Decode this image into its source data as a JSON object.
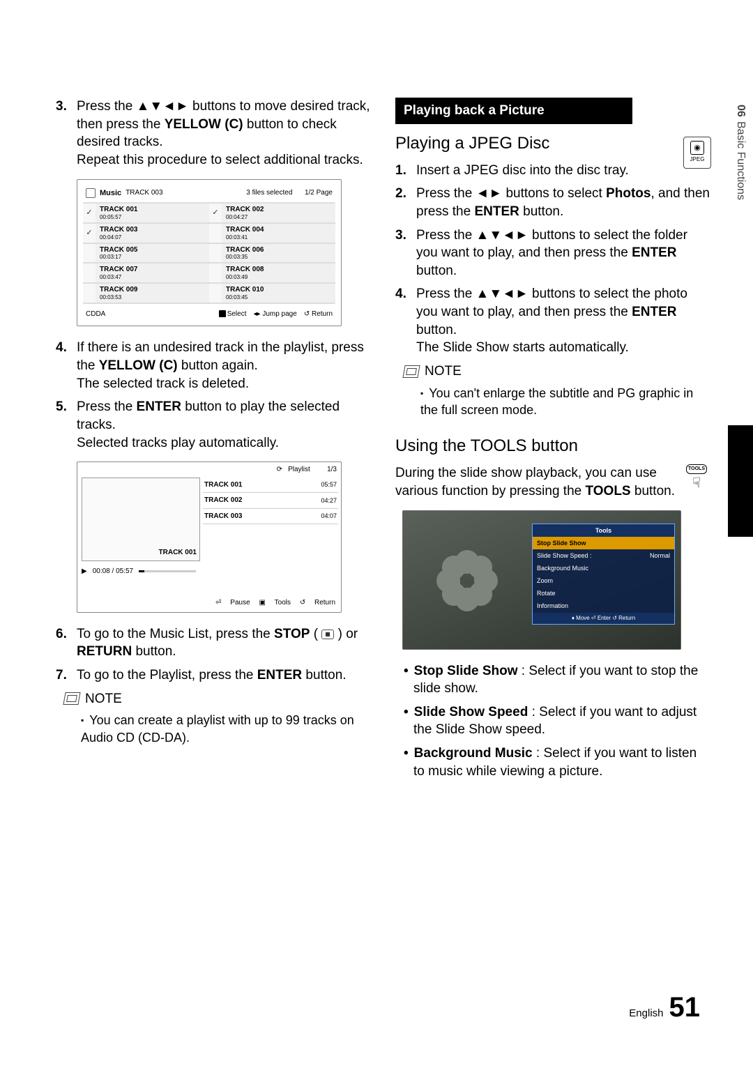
{
  "side": {
    "chapter": "06",
    "title": "Basic Functions"
  },
  "left": {
    "s3": {
      "num": "3.",
      "l1a": "Press the ",
      "l1arrows": "▲▼◄►",
      "l1b": " buttons to move desired track, then press the ",
      "l1c": "YELLOW (C)",
      "l1d": " button to check desired tracks.",
      "l2": "Repeat this procedure to select additional tracks."
    },
    "fig1": {
      "icon_title": "Music",
      "current": "TRACK 003",
      "files": "3 files selected",
      "page": "1/2 Page",
      "tracks": [
        {
          "chk": "✓",
          "name": "TRACK 001",
          "time": "00:05:57"
        },
        {
          "chk": "✓",
          "name": "TRACK 002",
          "time": "00:04:27"
        },
        {
          "chk": "✓",
          "name": "TRACK 003",
          "time": "00:04:07"
        },
        {
          "chk": "",
          "name": "TRACK 004",
          "time": "00:03:41"
        },
        {
          "chk": "",
          "name": "TRACK 005",
          "time": "00:03:17"
        },
        {
          "chk": "",
          "name": "TRACK 006",
          "time": "00:03:35"
        },
        {
          "chk": "",
          "name": "TRACK 007",
          "time": "00:03:47"
        },
        {
          "chk": "",
          "name": "TRACK 008",
          "time": "00:03:49"
        },
        {
          "chk": "",
          "name": "TRACK 009",
          "time": "00:03:53"
        },
        {
          "chk": "",
          "name": "TRACK 010",
          "time": "00:03:45"
        }
      ],
      "src": "CDDA",
      "k_select": "Select",
      "k_jump": "Jump page",
      "k_return": "Return"
    },
    "s4": {
      "num": "4.",
      "a": "If there is an undesired track in the playlist, press the ",
      "b": "YELLOW (C)",
      "c": " button again.",
      "d": "The selected track is deleted."
    },
    "s5": {
      "num": "5.",
      "a": "Press the ",
      "b": "ENTER",
      "c": " button to play the selected tracks.",
      "d": "Selected tracks play automatically."
    },
    "fig2": {
      "hdr_icon": "⟳",
      "hdr_label": "Playlist",
      "hdr_page": "1/3",
      "art": "TRACK 001",
      "rows": [
        {
          "n": "TRACK 001",
          "t": "05:57"
        },
        {
          "n": "TRACK 002",
          "t": "04:27"
        },
        {
          "n": "TRACK 003",
          "t": "04:07"
        }
      ],
      "prog": "00:08 / 05:57",
      "f_pause": "Pause",
      "f_tools": "Tools",
      "f_return": "Return"
    },
    "s6": {
      "num": "6.",
      "a": "To go to the Music List, press the ",
      "b": "STOP",
      "c": " ( ",
      "d": " ) or ",
      "e": "RETURN",
      "f": " button."
    },
    "s7": {
      "num": "7.",
      "a": "To go to the Playlist, press the ",
      "b": "ENTER",
      "c": " button."
    },
    "note_lbl": "NOTE",
    "note_txt": "You can create a playlist with up to 99 tracks on Audio CD (CD-DA)."
  },
  "right": {
    "black": "Playing back a Picture",
    "badge": {
      "glyph": "◉",
      "label": "JPEG"
    },
    "h_jpeg": "Playing a JPEG Disc",
    "j1": {
      "num": "1.",
      "t": "Insert a JPEG disc into the disc tray."
    },
    "j2": {
      "num": "2.",
      "a": "Press the ",
      "arr": "◄►",
      "b": " buttons to select ",
      "c": "Photos",
      "d": ", and then press the ",
      "e": "ENTER",
      "f": " button."
    },
    "j3": {
      "num": "3.",
      "a": "Press the ",
      "arr": "▲▼◄►",
      "b": " buttons to select the folder you want to play, and then press the ",
      "c": "ENTER",
      "d": " button."
    },
    "j4": {
      "num": "4.",
      "a": "Press the ",
      "arr": "▲▼◄►",
      "b": " buttons to select the photo you want to play, and then press the ",
      "c": "ENTER",
      "d": " button.",
      "e": "The Slide Show starts automatically."
    },
    "note_lbl": "NOTE",
    "note_txt": "You can't enlarge the subtitle and PG graphic in the full screen mode.",
    "h_tools": "Using the TOOLS button",
    "tools_p": {
      "a": "During the slide show playback, you can use various function by pressing the ",
      "b": "TOOLS",
      "c": " button."
    },
    "tools_badge": "TOOLS",
    "tmenu": {
      "title": "Tools",
      "rows": [
        {
          "l": "Stop Slide Show",
          "v": ""
        },
        {
          "l": "Slide Show Speed :",
          "v": "Normal"
        },
        {
          "l": "Background Music",
          "v": ""
        },
        {
          "l": "Zoom",
          "v": ""
        },
        {
          "l": "Rotate",
          "v": ""
        },
        {
          "l": "Information",
          "v": ""
        }
      ],
      "ftr": "♦ Move    ⏎ Enter    ↺ Return"
    },
    "bul": [
      {
        "b": "Stop Slide Show",
        "t": " : Select if you want to stop the slide show."
      },
      {
        "b": "Slide Show Speed",
        "t": " : Select if you want to adjust the Slide Show speed."
      },
      {
        "b": "Background Music",
        "t": " : Select if you want to listen to music while viewing a picture."
      }
    ]
  },
  "footer": {
    "lang": "English",
    "page": "51"
  }
}
